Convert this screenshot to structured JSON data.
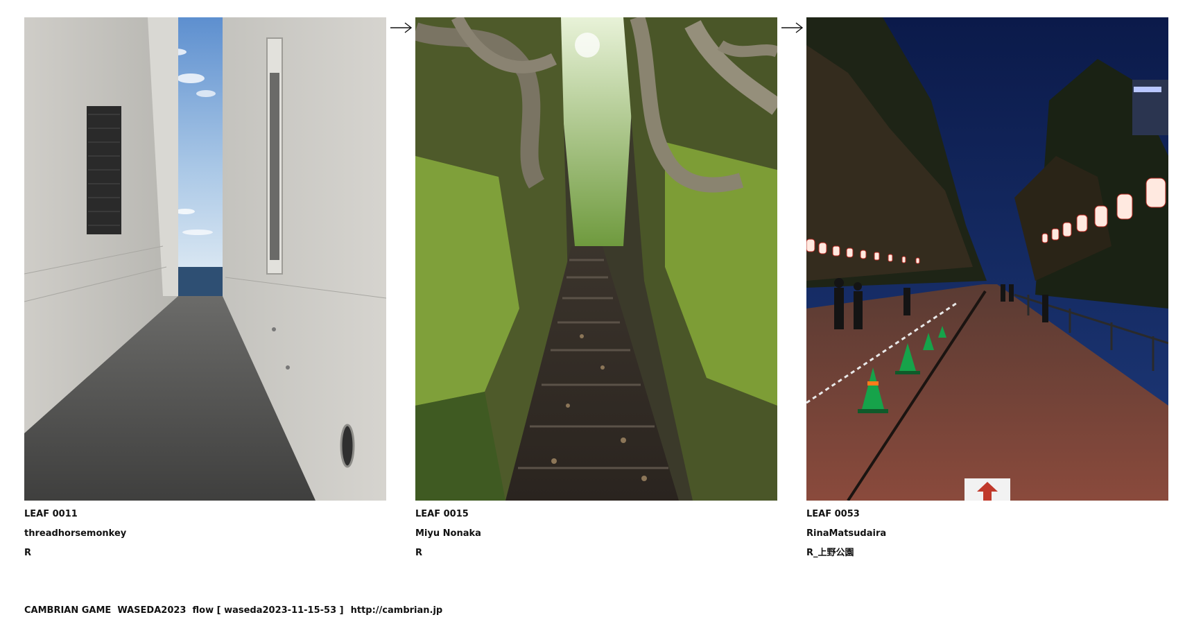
{
  "leaves": [
    {
      "id_label": "LEAF 0011",
      "author": "threadhorsemonkey",
      "tag": "R",
      "image_subject": "concrete alley between white buildings leading to the sea"
    },
    {
      "id_label": "LEAF 0015",
      "author": "Miyu Nonaka",
      "tag": "R",
      "image_subject": "mossy stone stairway between tree-rooted rock walls"
    },
    {
      "id_label": "LEAF 0053",
      "author": "RinaMatsudaira",
      "tag": "R_上野公園",
      "image_subject": "night path lined with paper lanterns and traffic cones"
    }
  ],
  "arrows": [
    "right-arrow-icon",
    "right-arrow-icon"
  ],
  "footer": {
    "project": "CAMBRIAN GAME  WASEDA2023  flow [ waseda2023-11-15-53 ]",
    "url": "http://cambrian.jp"
  },
  "colors": {
    "text": "#111111",
    "background": "#ffffff"
  }
}
